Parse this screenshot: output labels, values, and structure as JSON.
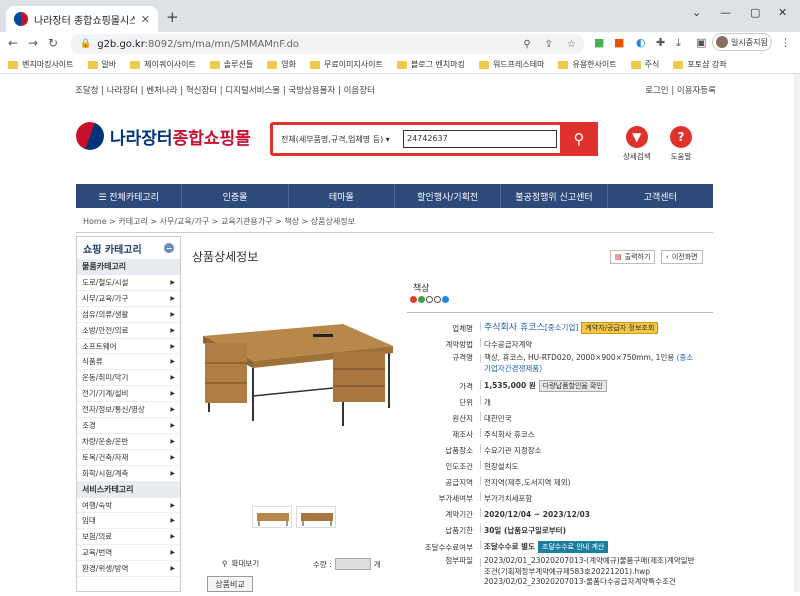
{
  "browser": {
    "tab_title": "나라장터 종합쇼핑몰시스템",
    "url_host": "g2b.go.kr",
    "url_path": ":8092/sm/ma/mn/SMMAMnF.do",
    "profile": "일시중지됨"
  },
  "bookmarks": [
    "벤치마킹사이트",
    "알바",
    "제이쿼이사이트",
    "솔루션들",
    "영화",
    "무료이미지사이트",
    "블로그 벤치마킹",
    "워드프레스테마",
    "유용한사이트",
    "주식",
    "포토샵 강좌"
  ],
  "util": {
    "left": "조달청 | 나라장터 | 벤처나라 | 혁신장터 | 디지털서비스몰 | 국방상용물자 | 이음장터",
    "right": "로그인 | 이용자등록"
  },
  "logo": {
    "part1": "나라장터",
    "part2": "종합쇼핑몰"
  },
  "search": {
    "scope": "전체(세부품명,규격,업체명 등)",
    "value": "24742637"
  },
  "quick": [
    {
      "icon": "▼",
      "label": "상세검색"
    },
    {
      "icon": "?",
      "label": "도움말"
    }
  ],
  "gnb": [
    "☰ 전체카테고리",
    "인증몰",
    "테마몰",
    "할인행사/기획전",
    "불공정행위 신고센터",
    "고객센터"
  ],
  "breadcrumb": "Home > 카테고리 > 사무/교육/가구 > 교육기관용가구 > 책상 > 상품상세정보",
  "sidebar": {
    "title": "쇼핑 카테고리",
    "cat1": "물품카테고리",
    "items1": [
      "도로/철도/시설",
      "사무/교육/가구",
      "섬유/의류/생활",
      "소방/안전/의료",
      "소프트웨어",
      "식품류",
      "운동/취미/악기",
      "전기/기계/설비",
      "전자/정보/통신/영상",
      "조경",
      "차량/운송/운반",
      "토목/건축/자재",
      "화학/시험/계측"
    ],
    "cat2": "서비스카테고리",
    "items2": [
      "여행/숙박",
      "임대",
      "보험/의료",
      "교육/번역",
      "환경/위생/방역"
    ]
  },
  "page": {
    "title": "상품상세정보",
    "print": "출력하기",
    "prev": "이전화면",
    "product_name": "책상"
  },
  "specs": {
    "vendor_label": "업체명",
    "vendor": "주식회사 휴코스",
    "vendor_size": "[중소기업]",
    "vendor_btn": "계약자/공급자 정보조회",
    "method_label": "계약방법",
    "method": "다수공급자계약",
    "spec_label": "규격명",
    "spec": "책상, 휴코스, HU-RTD020, 2000×900×750mm, 1인용",
    "spec_note": "(중소기업자간경쟁제품)",
    "price_label": "가격",
    "price": "1,535,000 원",
    "price_btn": "다량납품할인율 확인",
    "unit_label": "단위",
    "unit": "개",
    "origin_label": "원산지",
    "origin": "대한민국",
    "maker_label": "제조사",
    "maker": "주식회사 휴코스",
    "delivery_place_label": "납품장소",
    "delivery_place": "수요기관 지정장소",
    "handover_label": "인도조건",
    "handover": "현장설치도",
    "region_label": "공급지역",
    "region": "전지역(제주,도서지역 제외)",
    "vat_label": "부가세여부",
    "vat": "부가가치세포함",
    "period_label": "계약기간",
    "period": "2020/12/04 ~ 2023/12/03",
    "deadline_label": "납품기한",
    "deadline": "30일 (납품요구일로부터)",
    "fee_label": "조달수수료여부",
    "fee": "조달수수료 별도",
    "fee_btn": "조달수수료 안내 계산",
    "attach_label": "첨부파일",
    "attach1": "2023/02/01_23020207013-(계약예규)물품구매(제조)계약일반",
    "attach2": "조건(기획재정부계약예규제583호20221201).hwp",
    "attach3": "2023/02/02_23020207013-물품다수공급자계약특수조건"
  },
  "bottom": {
    "zoom": "확대보기",
    "qty_label": "수량 :",
    "qty_unit": "개",
    "compare": "상품비교"
  },
  "colors": {
    "gnb": "#2e4a7a",
    "accent": "#e0322d",
    "link": "#1a5fb4"
  }
}
